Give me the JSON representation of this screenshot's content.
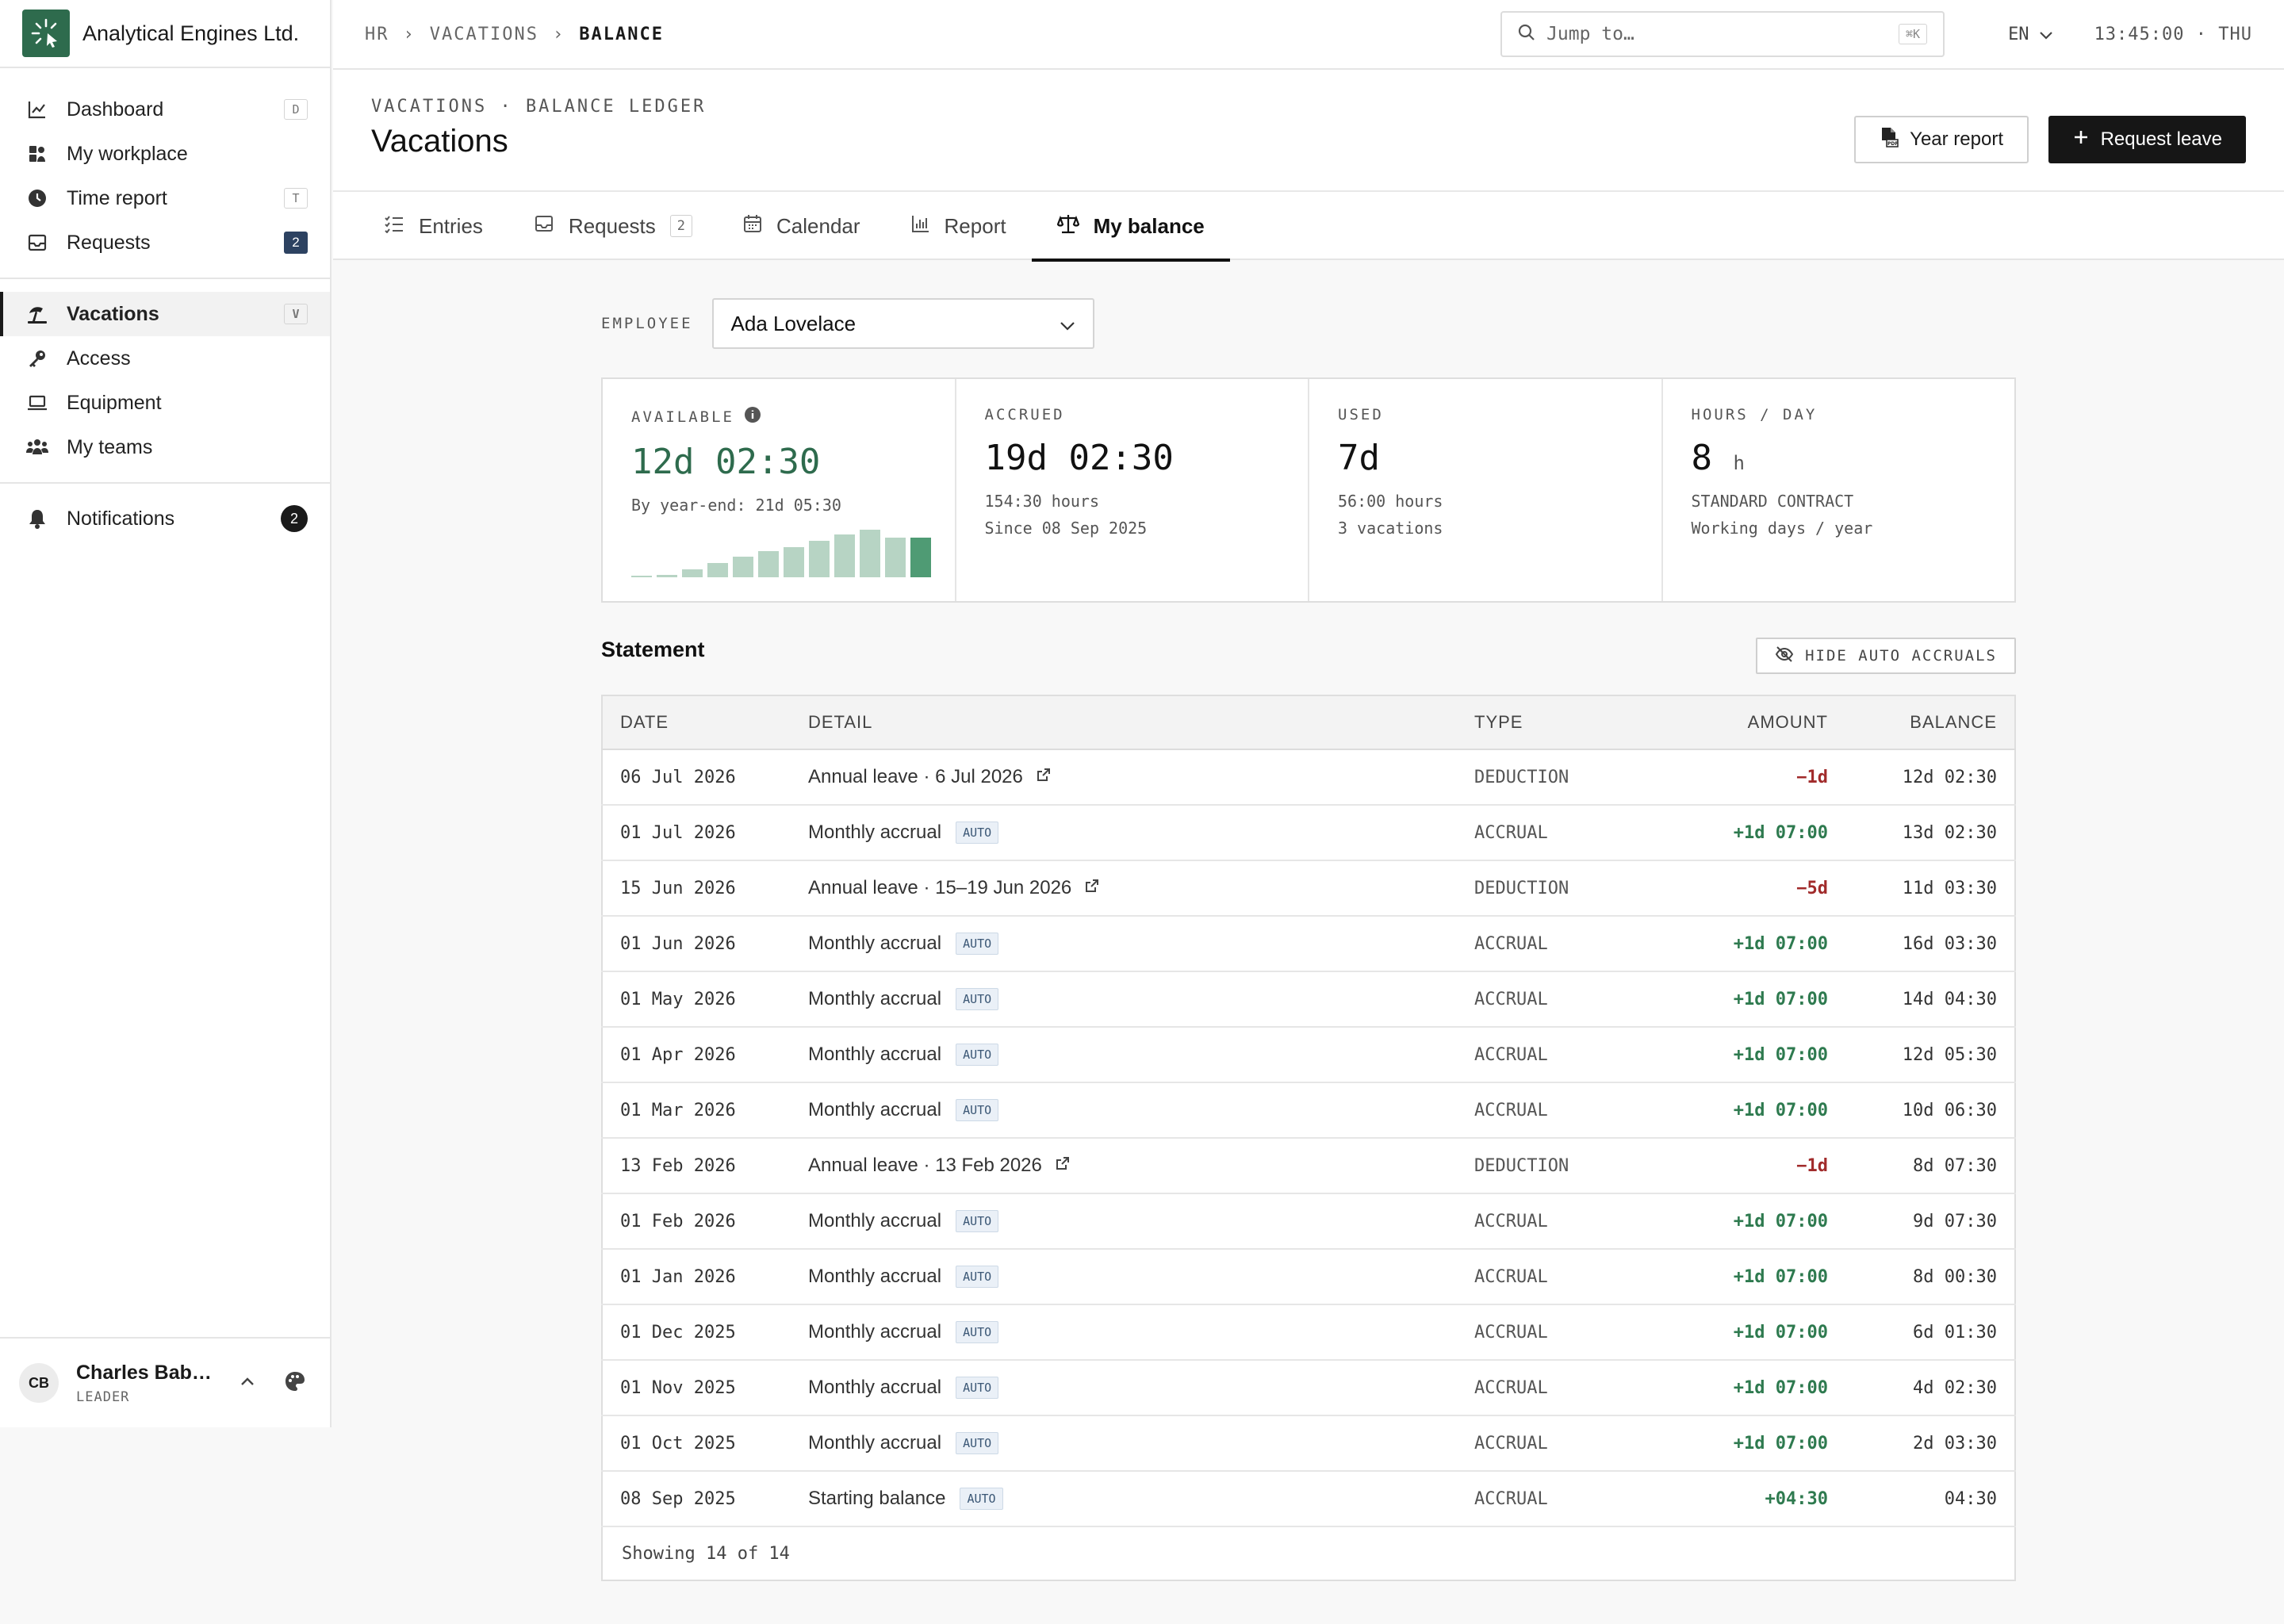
{
  "brand": {
    "name": "Analytical Engines Ltd."
  },
  "sidebar": {
    "items": [
      {
        "label": "Dashboard",
        "shortcut": "D"
      },
      {
        "label": "My workplace"
      },
      {
        "label": "Time report",
        "shortcut": "T"
      },
      {
        "label": "Requests",
        "badge": "2"
      },
      {
        "label": "Vacations",
        "shortcut": "V"
      },
      {
        "label": "Access"
      },
      {
        "label": "Equipment"
      },
      {
        "label": "My teams"
      },
      {
        "label": "Notifications",
        "badge": "2"
      }
    ],
    "user": {
      "initials": "CB",
      "name": "Charles Bab…",
      "role": "LEADER"
    }
  },
  "topbar": {
    "crumbs": [
      "HR",
      "›",
      "VACATIONS",
      "›",
      "BALANCE"
    ],
    "search_placeholder": "Jump to…",
    "search_shortcut": "⌘K",
    "lang": "EN",
    "clock": "13:45:00 · THU"
  },
  "header": {
    "overline": "VACATIONS · BALANCE LEDGER",
    "title": "Vacations",
    "year_report": "Year report",
    "request_leave": "Request leave"
  },
  "tabs": [
    {
      "label": "Entries"
    },
    {
      "label": "Requests",
      "count": "2"
    },
    {
      "label": "Calendar"
    },
    {
      "label": "Report"
    },
    {
      "label": "My balance"
    }
  ],
  "employee": {
    "label": "EMPLOYEE",
    "value": "Ada Lovelace"
  },
  "cards": {
    "available": {
      "label": "AVAILABLE",
      "value": "12d 02:30",
      "sub": "By year-end: 21d 05:30",
      "trend": [
        0.02,
        0.03,
        0.1,
        0.18,
        0.26,
        0.33,
        0.38,
        0.46,
        0.54,
        0.6,
        0.5,
        0.5
      ]
    },
    "accrued": {
      "label": "ACCRUED",
      "value": "19d 02:30",
      "sub1": "154:30 hours",
      "sub2": "Since 08 Sep 2025"
    },
    "used": {
      "label": "USED",
      "value": "7d",
      "sub1": "56:00 hours",
      "sub2": "3 vacations"
    },
    "hours": {
      "label": "HOURS / DAY",
      "value": "8",
      "unit": "h",
      "sub1": "STANDARD CONTRACT",
      "sub2": "Working days / year"
    }
  },
  "statement": {
    "title": "Statement",
    "hide_btn": "HIDE AUTO ACCRUALS",
    "columns": [
      "DATE",
      "DETAIL",
      "TYPE",
      "AMOUNT",
      "BALANCE"
    ],
    "auto_label": "AUTO",
    "rows": [
      {
        "date": "06 Jul 2026",
        "detail": "Annual leave · 6 Jul 2026",
        "link": true,
        "type": "DEDUCTION",
        "amount": "−1d",
        "balance": "12d 02:30"
      },
      {
        "date": "01 Jul 2026",
        "detail": "Monthly accrual",
        "auto": true,
        "type": "ACCRUAL",
        "amount": "+1d 07:00",
        "balance": "13d 02:30"
      },
      {
        "date": "15 Jun 2026",
        "detail": "Annual leave · 15–19 Jun 2026",
        "link": true,
        "type": "DEDUCTION",
        "amount": "−5d",
        "balance": "11d 03:30"
      },
      {
        "date": "01 Jun 2026",
        "detail": "Monthly accrual",
        "auto": true,
        "type": "ACCRUAL",
        "amount": "+1d 07:00",
        "balance": "16d 03:30"
      },
      {
        "date": "01 May 2026",
        "detail": "Monthly accrual",
        "auto": true,
        "type": "ACCRUAL",
        "amount": "+1d 07:00",
        "balance": "14d 04:30"
      },
      {
        "date": "01 Apr 2026",
        "detail": "Monthly accrual",
        "auto": true,
        "type": "ACCRUAL",
        "amount": "+1d 07:00",
        "balance": "12d 05:30"
      },
      {
        "date": "01 Mar 2026",
        "detail": "Monthly accrual",
        "auto": true,
        "type": "ACCRUAL",
        "amount": "+1d 07:00",
        "balance": "10d 06:30"
      },
      {
        "date": "13 Feb 2026",
        "detail": "Annual leave · 13 Feb 2026",
        "link": true,
        "type": "DEDUCTION",
        "amount": "−1d",
        "balance": "8d 07:30"
      },
      {
        "date": "01 Feb 2026",
        "detail": "Monthly accrual",
        "auto": true,
        "type": "ACCRUAL",
        "amount": "+1d 07:00",
        "balance": "9d 07:30"
      },
      {
        "date": "01 Jan 2026",
        "detail": "Monthly accrual",
        "auto": true,
        "type": "ACCRUAL",
        "amount": "+1d 07:00",
        "balance": "8d 00:30"
      },
      {
        "date": "01 Dec 2025",
        "detail": "Monthly accrual",
        "auto": true,
        "type": "ACCRUAL",
        "amount": "+1d 07:00",
        "balance": "6d 01:30"
      },
      {
        "date": "01 Nov 2025",
        "detail": "Monthly accrual",
        "auto": true,
        "type": "ACCRUAL",
        "amount": "+1d 07:00",
        "balance": "4d 02:30"
      },
      {
        "date": "01 Oct 2025",
        "detail": "Monthly accrual",
        "auto": true,
        "type": "ACCRUAL",
        "amount": "+1d 07:00",
        "balance": "2d 03:30"
      },
      {
        "date": "08 Sep 2025",
        "detail": "Starting balance",
        "auto": true,
        "type": "ACCRUAL",
        "amount": "+04:30",
        "balance": "04:30"
      }
    ],
    "footer": "Showing 14 of 14"
  },
  "colors": {
    "brand": "#2e6b4d",
    "positive": "#2e7a4f",
    "negative": "#a12b2b",
    "badge": "#2d4261"
  }
}
